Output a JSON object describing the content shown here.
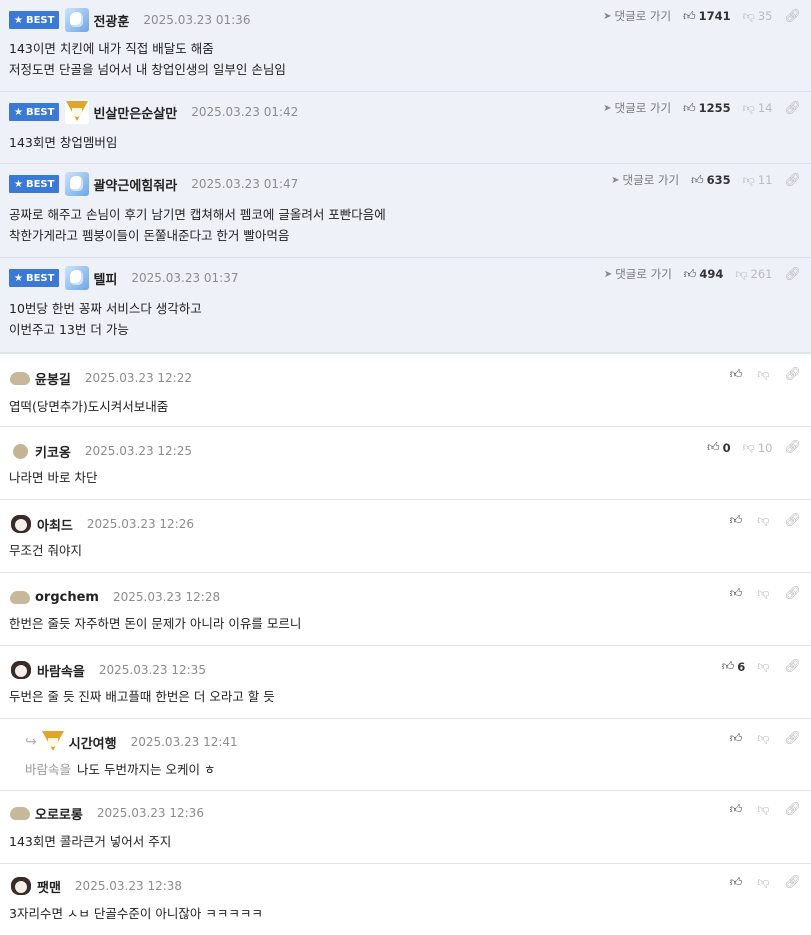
{
  "labels": {
    "best": "BEST",
    "goto": "댓글로 가기"
  },
  "best_comments": [
    {
      "nick": "전광훈",
      "avatar": "polar-bear-icon",
      "date": "2025.03.23 01:36",
      "up": "1741",
      "down": "35",
      "lines": [
        "143이면 치킨에 내가 직접 배달도 해줌",
        "저정도면 단골을 넘어서 내 창업인생의 일부인 손님임"
      ]
    },
    {
      "nick": "빈살만은순살만",
      "avatar": "fox-icon",
      "date": "2025.03.23 01:42",
      "up": "1255",
      "down": "14",
      "lines": [
        "143회면 창업멤버임"
      ]
    },
    {
      "nick": "괄약근에힘줘라",
      "avatar": "polar-bear-icon",
      "date": "2025.03.23 01:47",
      "up": "635",
      "down": "11",
      "lines": [
        "공짜로 해주고 손님이 후기 남기면 캡쳐해서 펨코에 글올려서 포빤다음에",
        "착한가게라고 펨붕이들이 돈쭐내준다고 한거 빨아먹음"
      ]
    },
    {
      "nick": "텔피",
      "avatar": "polar-bear-icon",
      "date": "2025.03.23 01:37",
      "up": "494",
      "down": "261",
      "lines": [
        "10번당 한번 꽁짜 서비스다 생각하고",
        "이번주고 13번 더 가능"
      ]
    }
  ],
  "comments": [
    {
      "nick": "윤봉길",
      "avatar": "blob-icon",
      "date": "2025.03.23 12:22",
      "up": "",
      "down": "",
      "reply": false,
      "mention": "",
      "text": "엽떡(당면추가)도시켜서보내줌"
    },
    {
      "nick": "키코옹",
      "avatar": "ball-icon",
      "date": "2025.03.23 12:25",
      "up": "0",
      "down": "10",
      "reply": false,
      "mention": "",
      "text": "나라면 바로 차단"
    },
    {
      "nick": "아최드",
      "avatar": "dog-icon",
      "date": "2025.03.23 12:26",
      "up": "",
      "down": "",
      "reply": false,
      "mention": "",
      "text": "무조건 줘야지"
    },
    {
      "nick": "orgchem",
      "avatar": "blob-icon",
      "date": "2025.03.23 12:28",
      "up": "",
      "down": "",
      "reply": false,
      "mention": "",
      "text": "한번은 줄듯 자주하면 돈이 문제가 아니라 이유를 모르니"
    },
    {
      "nick": "바람속을",
      "avatar": "dog-icon",
      "date": "2025.03.23 12:35",
      "up": "6",
      "down": "",
      "reply": false,
      "mention": "",
      "text": "두번은 줄 듯 진짜 배고플때 한번은 더 오라고 할 듯"
    },
    {
      "nick": "시간여행",
      "avatar": "fox-icon",
      "date": "2025.03.23 12:41",
      "up": "",
      "down": "",
      "reply": true,
      "mention": "바람속을",
      "text": "나도 두번까지는 오케이 ㅎ"
    },
    {
      "nick": "오로로롱",
      "avatar": "blob-icon",
      "date": "2025.03.23 12:36",
      "up": "",
      "down": "",
      "reply": false,
      "mention": "",
      "text": "143회면 콜라큰거 넣어서 주지"
    },
    {
      "nick": "팻맨",
      "avatar": "dog-icon",
      "date": "2025.03.23 12:38",
      "up": "",
      "down": "",
      "reply": false,
      "mention": "",
      "text": "3자리수면 ㅅㅂ 단골수준이 아니잖아 ㅋㅋㅋㅋㅋ"
    }
  ]
}
